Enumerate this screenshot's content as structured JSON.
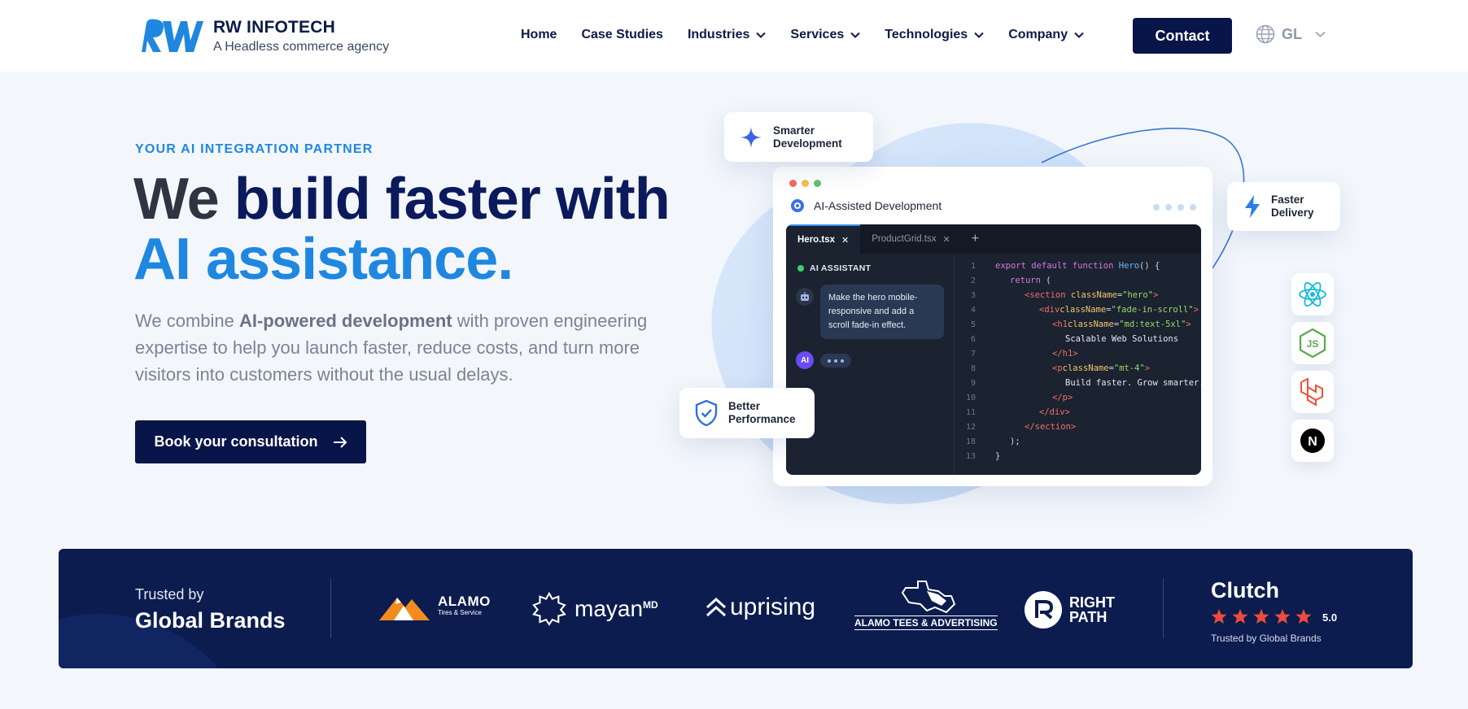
{
  "header": {
    "brand_name": "RW INFOTECH",
    "tagline": "A Headless commerce agency",
    "nav": [
      {
        "label": "Home",
        "has_dropdown": false
      },
      {
        "label": "Case Studies",
        "has_dropdown": false
      },
      {
        "label": "Industries",
        "has_dropdown": true
      },
      {
        "label": "Services",
        "has_dropdown": true
      },
      {
        "label": "Technologies",
        "has_dropdown": true
      },
      {
        "label": "Company",
        "has_dropdown": true
      }
    ],
    "contact_label": "Contact",
    "language": {
      "label": "GL",
      "icon": "globe-icon"
    }
  },
  "hero": {
    "eyebrow": "YOUR AI INTEGRATION PARTNER",
    "headline_word1": "We",
    "headline_word2": "build faster with",
    "headline_line2": "AI assistance.",
    "lead_pre": "We combine ",
    "lead_bold": "AI-powered development",
    "lead_post": " with proven engineering expertise to help you launch faster, reduce costs, and turn more visitors into customers without the usual delays.",
    "cta_label": "Book your consultation"
  },
  "illustration": {
    "window_title": "AI-Assisted Development",
    "tabs": [
      {
        "label": "Hero.tsx",
        "active": true
      },
      {
        "label": "ProductGrid.tsx",
        "active": false
      }
    ],
    "assistant_label": "AI ASSISTANT",
    "user_message": "Make the hero mobile-responsive and add a scroll fade-in effect.",
    "ai_badge": "AI",
    "line_numbers": [
      "1",
      "2",
      "3",
      "4",
      "5",
      "6",
      "7",
      "8",
      "9",
      "10",
      "11",
      "12",
      "18",
      "13"
    ],
    "code_texts": {
      "export_default": "export default",
      "function": "function",
      "hero_fn": "Hero",
      "open_paren": "() {",
      "return_kw": "return",
      "return_paren": " (",
      "section_open": "<section",
      "classname_attr": "className",
      "section_class": "\"hero\"",
      "div_open": "<div",
      "div_class": "\"fade-in-scroll\"",
      "h1_open": "<h1",
      "h1_class": "\"md:text-5xl\"",
      "h1_content": "Scalable Web Solutions",
      "h1_close": "</h1>",
      "p_open": "<p",
      "p_class": "\"mt-4\"",
      "p_content": "Build faster. Grow smarter.",
      "p_close": "</p>",
      "div_close": "</div>",
      "section_close": "</section>",
      "paren_close": ");",
      "brace_close": "}",
      "gt": ">",
      "eq": "="
    },
    "cards": {
      "smarter": "Smarter Development",
      "faster": "Faster Delivery",
      "better": "Better Performance"
    },
    "tech_icons": [
      "react-icon",
      "nodejs-icon",
      "laravel-icon",
      "nextjs-icon"
    ],
    "tech_letters": {
      "node": "JS",
      "next": "N"
    }
  },
  "trust": {
    "trusted_by": "Trusted by",
    "global_brands": "Global Brands",
    "brands": {
      "alamo_name": "ALAMO",
      "alamo_sub": "Tires & Service",
      "mayan": "mayan",
      "mayan_sup": "MD",
      "uprising": "uprising",
      "alamo_tees": "ALAMO TEES & ADVERTISING",
      "right": "RIGHT",
      "path": "PATH"
    },
    "clutch": {
      "title": "Clutch",
      "stars": 5,
      "rating": "5.0",
      "subtitle": "Trusted by Global Brands"
    }
  },
  "colors": {
    "navy": "#071549",
    "accent_blue": "#1f87e0",
    "band": "#0c1c4f",
    "star": "#ef4b3b"
  }
}
